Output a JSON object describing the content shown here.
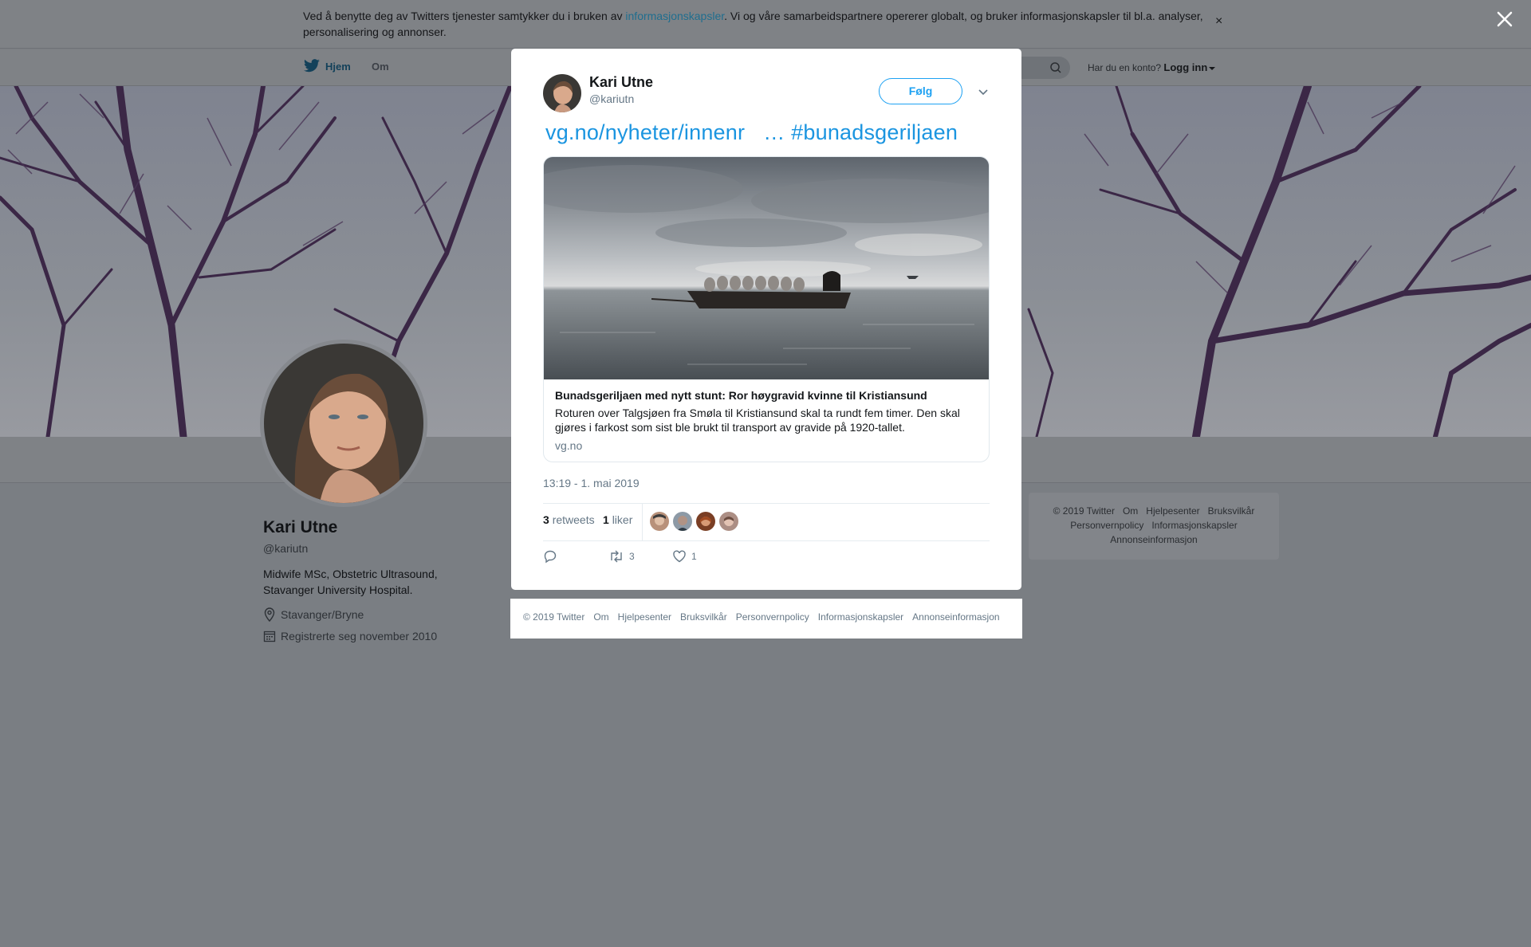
{
  "cookie_bar": {
    "text_before": "Ved å benytte deg av Twitters tjenester samtykker du i bruken av ",
    "link": "informasjonskapsler",
    "text_after": ". Vi og våre samarbeidspartnere opererer globalt, og bruker informasjonskapsler til bl.a. analyser, personalisering og annonser.",
    "close": "×"
  },
  "nav": {
    "home": "Hjem",
    "about": "Om",
    "login_question": "Har du en konto?",
    "login": "Logg inn"
  },
  "profile": {
    "name": "Kari Utne",
    "handle": "@kariutn",
    "bio": "Midwife MSc, Obstetric Ultrasound, Stavanger University Hospital.",
    "location": "Stavanger/Bryne",
    "joined": "Registrerte seg november 2010"
  },
  "right_footer": [
    "© 2019 Twitter",
    "Om",
    "Hjelpesenter",
    "Bruksvilkår",
    "Personvernpolicy",
    "Informasjonskapsler",
    "Annonseinformasjon"
  ],
  "tweet": {
    "name": "Kari Utne",
    "handle": "@kariutn",
    "follow": "Følg",
    "text": "vg.no/nyheter/innenr   … #bunadsgeriljaen",
    "card": {
      "title": "Bunadsgeriljaen med nytt stunt: Ror høygravid kvinne til Kristiansund",
      "description": "Roturen over Talgsjøen fra Smøla til Kristiansund skal ta rundt fem timer. Den skal gjøres i farkost som sist ble brukt til transport av gravide på 1920-tallet.",
      "domain": "vg.no"
    },
    "time": "13:19 - 1. mai 2019",
    "retweets": "3",
    "retweets_label": "retweets",
    "likes": "1",
    "likes_label": "liker",
    "action_retweets": "3",
    "action_likes": "1"
  },
  "modal_footer": [
    "© 2019 Twitter",
    "Om",
    "Hjelpesenter",
    "Bruksvilkår",
    "Personvernpolicy",
    "Informasjonskapsler",
    "Annonseinformasjon"
  ],
  "colors": {
    "accent": "#1da1f2",
    "link": "#1b95e0",
    "overlay": "#7a7e83"
  }
}
